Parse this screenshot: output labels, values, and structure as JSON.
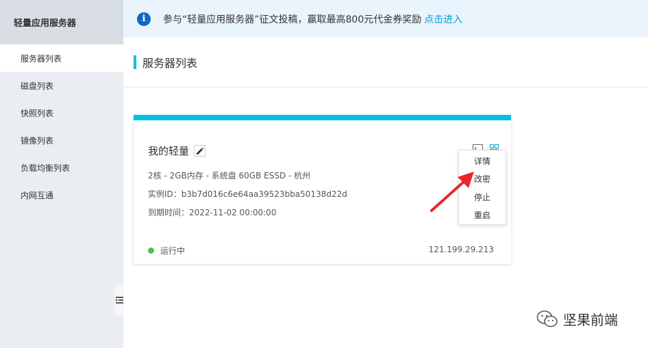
{
  "sidebar": {
    "title": "轻量应用服务器",
    "items": [
      {
        "label": "服务器列表"
      },
      {
        "label": "磁盘列表"
      },
      {
        "label": "快照列表"
      },
      {
        "label": "镜像列表"
      },
      {
        "label": "负载均衡列表"
      },
      {
        "label": "内网互通"
      }
    ]
  },
  "banner": {
    "text": "参与“轻量应用服务器”征文投稿，赢取最高800元代金券奖励",
    "link": "点击进入",
    "info_icon": "i"
  },
  "page": {
    "title": "服务器列表"
  },
  "card": {
    "name": "我的轻量",
    "spec": "2核 - 2GB内存 - 系统盘 60GB ESSD - 杭州",
    "instance_id": "实例ID：b3b7d016c6e64aa39523bba50138d22d",
    "expiry": "到期时间：2022-11-02 00:00:00",
    "status": "运行中",
    "ip": "121.199.29.213",
    "accent_color": "#00c1de",
    "status_color": "#4ec14e"
  },
  "menu": {
    "items": [
      {
        "label": "详情"
      },
      {
        "label": "改密"
      },
      {
        "label": "停止"
      },
      {
        "label": "重启"
      }
    ]
  },
  "watermark": {
    "text": "坚果前端"
  }
}
